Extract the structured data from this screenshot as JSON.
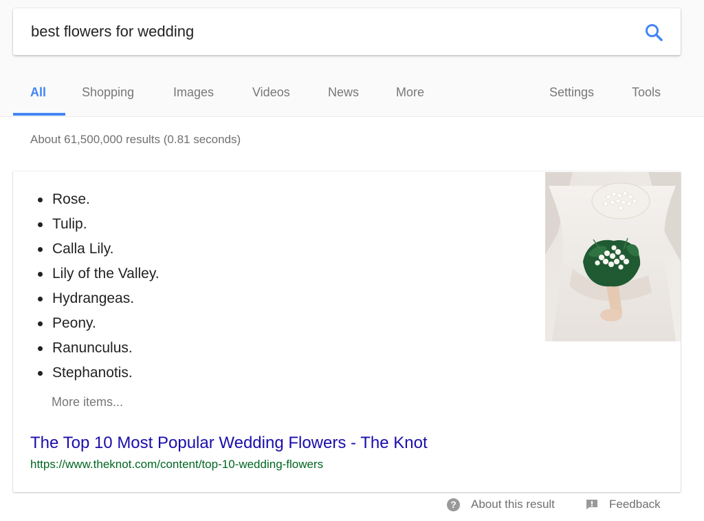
{
  "search": {
    "query": "best flowers for wedding",
    "icon": "search-icon",
    "accent_color": "#4285f4"
  },
  "tabs": [
    {
      "label": "All",
      "active": true
    },
    {
      "label": "Shopping",
      "active": false
    },
    {
      "label": "Images",
      "active": false
    },
    {
      "label": "Videos",
      "active": false
    },
    {
      "label": "News",
      "active": false
    },
    {
      "label": "More",
      "active": false
    },
    {
      "label": "Settings",
      "active": false
    },
    {
      "label": "Tools",
      "active": false
    }
  ],
  "results_stats": "About 61,500,000 results (0.81 seconds)",
  "snippet": {
    "items": [
      "Rose.",
      "Tulip.",
      "Calla Lily.",
      "Lily of the Valley.",
      "Hydrangeas.",
      "Peony.",
      "Ranunculus.",
      "Stephanotis."
    ],
    "more_items_label": "More items...",
    "title": "The Top 10 Most Popular Wedding Flowers - The Knot",
    "url": "https://www.theknot.com/content/top-10-wedding-flowers",
    "title_color": "#1a0dab",
    "url_color": "#006621"
  },
  "footer": {
    "about_label": "About this result",
    "about_icon": "help-icon",
    "feedback_label": "Feedback",
    "feedback_icon": "feedback-icon"
  }
}
